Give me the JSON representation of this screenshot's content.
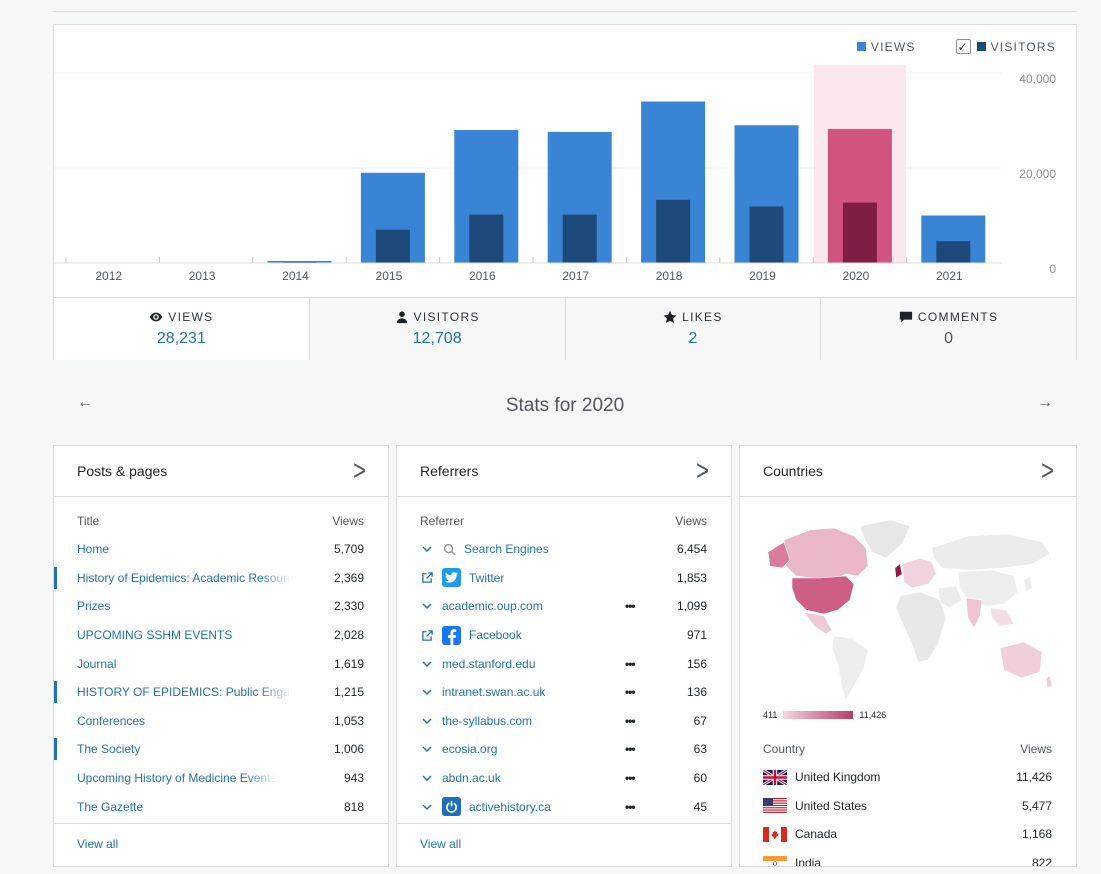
{
  "legend": {
    "views": "VIEWS",
    "visitors": "VISITORS",
    "check": "✓",
    "views_color": "#3a84d6",
    "visitors_color": "#1d4a7a"
  },
  "chart_data": {
    "type": "bar",
    "categories": [
      "2012",
      "2013",
      "2014",
      "2015",
      "2016",
      "2017",
      "2018",
      "2019",
      "2020",
      "2021"
    ],
    "series": [
      {
        "name": "VIEWS",
        "values": [
          0,
          0,
          300,
          19000,
          28000,
          27600,
          34000,
          29000,
          28231,
          10000
        ]
      },
      {
        "name": "VISITORS",
        "values": [
          0,
          0,
          100,
          7000,
          10200,
          10200,
          13300,
          11900,
          12708,
          4600
        ]
      }
    ],
    "highlight_index": 8,
    "highlight_colors": {
      "views": "#d05380",
      "visitors": "#7f1d44",
      "band": "#fbe8ee"
    },
    "y_ticks": [
      "0",
      "20,000",
      "40,000"
    ],
    "ylim": [
      0,
      40000
    ]
  },
  "tabs": [
    {
      "label": "VIEWS",
      "value": "28,231",
      "icon": "eye-icon"
    },
    {
      "label": "VISITORS",
      "value": "12,708",
      "icon": "person-icon"
    },
    {
      "label": "LIKES",
      "value": "2",
      "icon": "star-icon"
    },
    {
      "label": "COMMENTS",
      "value": "0",
      "icon": "comment-icon"
    }
  ],
  "period": {
    "prev": "←",
    "next": "→",
    "title": "Stats for 2020"
  },
  "posts": {
    "title": "Posts & pages",
    "chevron": ">",
    "col_title": "Title",
    "col_views": "Views",
    "rows": [
      {
        "title": "Home",
        "views": "5,709"
      },
      {
        "title": "History of Epidemics: Academic Resources",
        "views": "2,369"
      },
      {
        "title": "Prizes",
        "views": "2,330"
      },
      {
        "title": "UPCOMING SSHM EVENTS",
        "views": "2,028"
      },
      {
        "title": "Journal",
        "views": "1,619"
      },
      {
        "title": "HISTORY OF EPIDEMICS: Public Engagement",
        "views": "1,215"
      },
      {
        "title": "Conferences",
        "views": "1,053"
      },
      {
        "title": "The Society",
        "views": "1,006"
      },
      {
        "title": "Upcoming History of Medicine Events",
        "views": "943"
      },
      {
        "title": "The Gazette",
        "views": "818"
      }
    ],
    "view_all": "View all"
  },
  "referrers": {
    "title": "Referrers",
    "chevron": ">",
    "col_title": "Referrer",
    "col_views": "Views",
    "dots": "•••",
    "rows": [
      {
        "name": "Search Engines",
        "views": "6,454"
      },
      {
        "name": "Twitter",
        "views": "1,853"
      },
      {
        "name": "academic.oup.com",
        "views": "1,099"
      },
      {
        "name": "Facebook",
        "views": "971"
      },
      {
        "name": "med.stanford.edu",
        "views": "156"
      },
      {
        "name": "intranet.swan.ac.uk",
        "views": "136"
      },
      {
        "name": "the-syllabus.com",
        "views": "67"
      },
      {
        "name": "ecosia.org",
        "views": "63"
      },
      {
        "name": "abdn.ac.uk",
        "views": "60"
      },
      {
        "name": "activehistory.ca",
        "views": "45"
      }
    ],
    "view_all": "View all"
  },
  "countries": {
    "title": "Countries",
    "chevron": ">",
    "scale_min": "411",
    "scale_max": "11,426",
    "col_title": "Country",
    "col_views": "Views",
    "rows": [
      {
        "name": "United Kingdom",
        "views": "11,426"
      },
      {
        "name": "United States",
        "views": "5,477"
      },
      {
        "name": "Canada",
        "views": "1,168"
      },
      {
        "name": "India",
        "views": "822"
      }
    ]
  }
}
